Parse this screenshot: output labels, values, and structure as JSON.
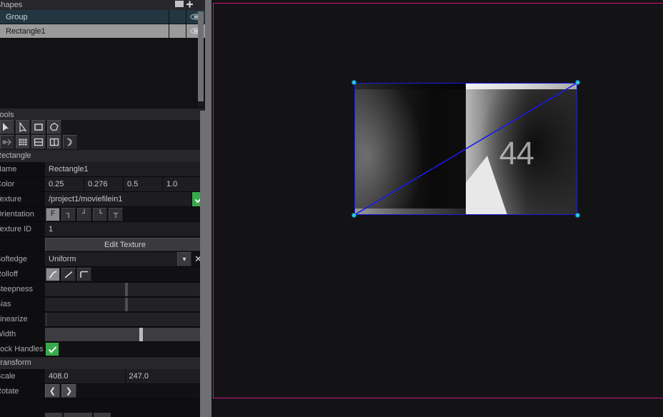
{
  "shapes_panel": {
    "title": "Shapes",
    "add_icon": "add-shape-icon",
    "rows": [
      {
        "name": "Group",
        "visibility_icon": "eye-icon"
      },
      {
        "name": "Rectangle1",
        "visibility_icon": "eye-icon"
      }
    ]
  },
  "tools_panel": {
    "title": "Tools",
    "row1": [
      {
        "icon": "select-arrow-icon",
        "active": true
      },
      {
        "icon": "pointer-edit-icon",
        "active": true
      },
      {
        "icon": "rectangle-tool-icon",
        "active": true
      },
      {
        "icon": "polygon-tool-icon",
        "active": true
      }
    ],
    "row2": [
      {
        "icon": "bezier-point-icon",
        "active": false
      },
      {
        "icon": "grid-tool-icon",
        "active": true
      },
      {
        "icon": "split-horizontal-icon",
        "active": true
      },
      {
        "icon": "split-vertical-icon",
        "active": true
      },
      {
        "icon": "curve-tool-icon",
        "active": false
      }
    ]
  },
  "properties": {
    "title": "Rectangle",
    "name_label": "Name",
    "name_value": "Rectangle1",
    "color_label": "Color",
    "color_values": [
      "0.25",
      "0.276",
      "0.5",
      "1.0"
    ],
    "color_swatch": "#3f4180",
    "texture_label": "Texture",
    "texture_value": "/project1/moviefilein1",
    "texture_enabled_icon": "check-icon",
    "orientation_label": "Orientation",
    "orientation_options": [
      "F",
      "┐",
      "┘",
      "└",
      "┬"
    ],
    "orientation_selected": 0,
    "texture_id_label": "Texture ID",
    "texture_id_value": "1",
    "edit_texture_label": "Edit Texture",
    "softedge_label": "Softedge",
    "softedge_value": "Uniform",
    "softedge_dropdown_icon": "chevron-down-icon",
    "softedge_clear_icon": "close-icon",
    "rolloff_label": "Rolloff",
    "rolloff_options": [
      "s-curve-icon",
      "linear-icon",
      "step-curve-icon"
    ],
    "rolloff_selected": 0,
    "steepness_label": "Steepness",
    "steepness_pct": 50,
    "bias_label": "Bias",
    "bias_pct": 50,
    "linearize_label": "Linearize",
    "linearize_pct": 0,
    "width_label": "Width",
    "width_pct": 59,
    "lock_handles_label": "Lock Handles",
    "lock_handles_checked_icon": "check-icon"
  },
  "transform": {
    "title": "Transform",
    "scale_label": "Scale",
    "scale_x": "408.0",
    "scale_y": "247.0",
    "rotate_label": "Rotate",
    "rotate_prev_icon": "chevron-left-icon",
    "rotate_next_icon": "chevron-right-icon"
  },
  "viewport": {
    "border_color": "#d2127d",
    "selection_color": "#1a1ae6",
    "handle_color": "#2ec8f0",
    "texture_number": "44"
  }
}
